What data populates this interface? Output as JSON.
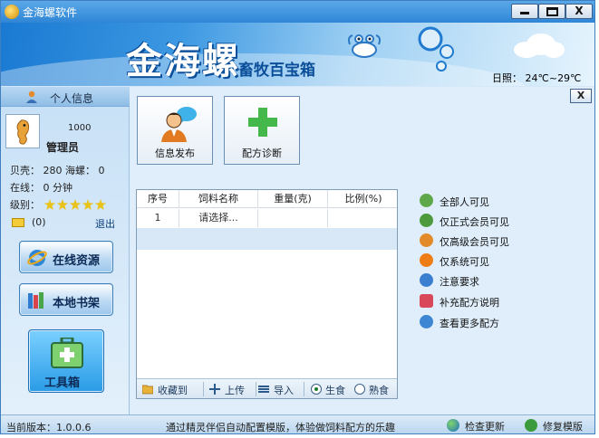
{
  "window": {
    "title": "金海螺软件",
    "close_label": "X"
  },
  "banner": {
    "brand": "金海螺",
    "subtitle": "畜牧百宝箱",
    "weather": "日照： 24℃~29℃"
  },
  "profile": {
    "header": "个人信息",
    "id": "1000",
    "name": "管理员",
    "shell": "贝壳：  280  海螺：  0",
    "online": "在线：  0  分钟",
    "level": "级别：",
    "level_stars": 5,
    "mail_count": "(0)",
    "logout": "退出"
  },
  "sidebar": {
    "online_resources": "在线资源",
    "local_bookshelf": "本地书架",
    "toolbox": "工具箱"
  },
  "panel": {
    "close_label": "X",
    "publish": "信息发布",
    "diagnose": "配方诊断"
  },
  "table": {
    "headers": [
      "序号",
      "饲料名称",
      "重量(克)",
      "比例(%)"
    ],
    "rows": [
      [
        "1",
        "请选择...",
        "",
        ""
      ]
    ]
  },
  "footer": {
    "favorite": "收藏到",
    "upload": "上传",
    "import": "导入",
    "raw": "生食",
    "cooked": "熟食",
    "selected": "raw"
  },
  "options": [
    {
      "label": "全部人可见",
      "icon": "check-circle-icon",
      "color": "#5fa84a"
    },
    {
      "label": "仅正式会员可见",
      "icon": "user-green-icon",
      "color": "#4c9a3c"
    },
    {
      "label": "仅高级会员可见",
      "icon": "user-orange-icon",
      "color": "#e38a2a"
    },
    {
      "label": "仅系统可见",
      "icon": "alert-icon",
      "color": "#ef7d16"
    },
    {
      "label": "注意要求",
      "icon": "help-icon",
      "color": "#3b7fd1"
    },
    {
      "label": "补充配方说明",
      "icon": "edit-icon",
      "color": "#d8475a"
    },
    {
      "label": "查看更多配方",
      "icon": "search-icon",
      "color": "#3c86d4"
    }
  ],
  "statusbar": {
    "version": "当前版本：1.0.0.6",
    "tip": "通过精灵伴侣自动配置模版，体验做饲料配方的乐趣",
    "check_update": "检查更新",
    "repair_template": "修复模版"
  }
}
